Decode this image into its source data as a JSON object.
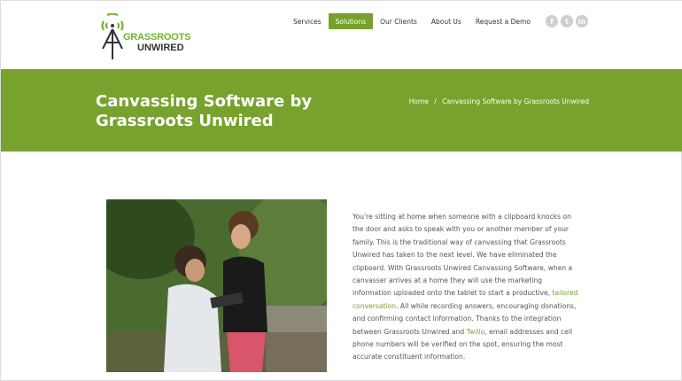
{
  "logo": {
    "line1": "GRASSROOTS",
    "line2": "UNWIRED"
  },
  "nav": [
    {
      "label": "Services"
    },
    {
      "label": "Solutions",
      "active": true
    },
    {
      "label": "Our Clients"
    },
    {
      "label": "About Us"
    },
    {
      "label": "Request a Demo"
    }
  ],
  "social": [
    {
      "icon": "facebook-icon",
      "glyph": "f"
    },
    {
      "icon": "twitter-icon",
      "glyph": "t"
    },
    {
      "icon": "linkedin-icon",
      "glyph": "in"
    }
  ],
  "banner": {
    "title": "Canvassing Software by Grassroots Unwired",
    "breadcrumb": {
      "home": "Home",
      "separator": "/",
      "current": "Canvassing Software by Grassroots Unwired"
    }
  },
  "content": {
    "p1": "You're sitting at home when someone with a clipboard knocks on the door and asks to speak with you or another member of your family. This is the traditional way of canvassing that Grassroots Unwired has taken to the next level. We have eliminated the clipboard. With Grassroots Unwired Canvassing Software, when a canvasser arrives at a home they will use the marketing information uploaded onto the tablet to start a productive, ",
    "link1": "tailored conversation",
    "p2": ". All while recording answers, encouraging donations, and confirming contact information. Thanks to the integration between Grassroots Unwired and ",
    "link2": "Twilio",
    "p3": ", email addresses and cell phone numbers will be verified on the spot, ensuring the most accurate constituent information."
  },
  "colors": {
    "brand_green": "#77a22d",
    "logo_green": "#6fb52c"
  }
}
